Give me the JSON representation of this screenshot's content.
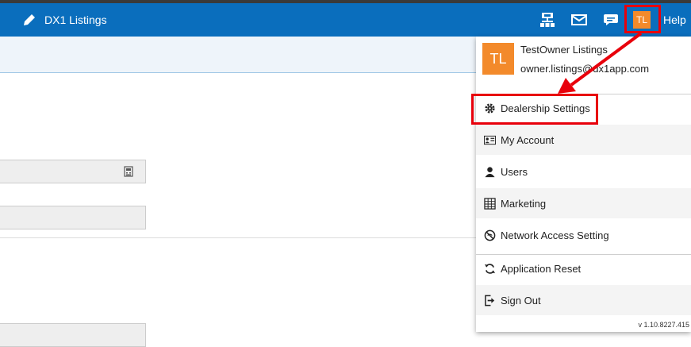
{
  "header": {
    "app_title": "DX1 Listings",
    "avatar_initials": "TL",
    "help_label": "Help",
    "icons": [
      "edit-icon",
      "org-chart-icon",
      "mail-icon",
      "chat-icon"
    ]
  },
  "user_menu": {
    "avatar_initials": "TL",
    "name": "TestOwner Listings",
    "email": "owner.listings@dx1app.com",
    "items": [
      {
        "label": "Dealership Settings",
        "icon": "gear-icon"
      },
      {
        "label": "My Account",
        "icon": "id-card-icon"
      },
      {
        "label": "Users",
        "icon": "user-icon"
      },
      {
        "label": "Marketing",
        "icon": "table-icon"
      },
      {
        "label": "Network Access Setting",
        "icon": "no-network-icon"
      },
      {
        "label": "Application Reset",
        "icon": "refresh-icon"
      },
      {
        "label": "Sign Out",
        "icon": "sign-out-icon"
      }
    ],
    "version": "v 1.10.8227.415"
  },
  "colors": {
    "navbar": "#0a6ebd",
    "avatar": "#f38a2b",
    "annotation": "#e8000b"
  }
}
